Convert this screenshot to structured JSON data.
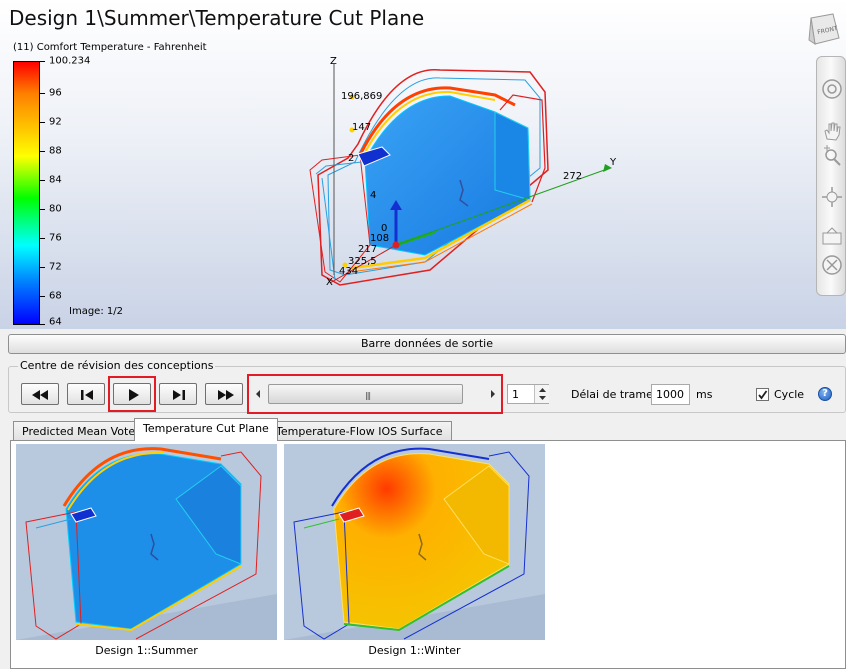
{
  "viewport": {
    "title": "Design 1\\Summer\\Temperature Cut Plane",
    "legend_title": "(11) Comfort Temperature - Fahrenheit",
    "colorbar_labels": [
      "100.234",
      "96",
      "92",
      "88",
      "84",
      "80",
      "76",
      "72",
      "68",
      "64"
    ],
    "image_counter": "Image: 1/2",
    "axis_labels": {
      "z": "Z",
      "y": "Y",
      "x": "X",
      "z_top": "196,869",
      "z_mid": "147",
      "z_mid2": "4",
      "z_low": "2",
      "y_end": "272",
      "origin_a": "0",
      "origin_b": "108",
      "x1": "217",
      "x2": "325,5",
      "x3": "434"
    },
    "rotator_label": "FRONT"
  },
  "output_bar": {
    "label": "Barre données de sortie"
  },
  "review": {
    "title": "Centre de révision des conceptions",
    "frame_index": "1",
    "frame_delay_label": "Délai de trame:",
    "frame_delay_value": "1000",
    "frame_delay_unit": "ms",
    "cycle_label": "Cycle",
    "cycle_checked": true,
    "help": "?"
  },
  "tabs": [
    {
      "label": "Predicted Mean Vote",
      "active": false
    },
    {
      "label": "Temperature Cut Plane",
      "active": true
    },
    {
      "label": "Temperature-Flow IOS Surface",
      "active": false
    }
  ],
  "thumbnails": [
    {
      "caption": "Design 1::Summer"
    },
    {
      "caption": "Design 1::Winter"
    }
  ],
  "colors": {
    "highlight": "#e21b24",
    "summer_fill": "#1e8fe8",
    "winter_fill": "#f5c400"
  }
}
